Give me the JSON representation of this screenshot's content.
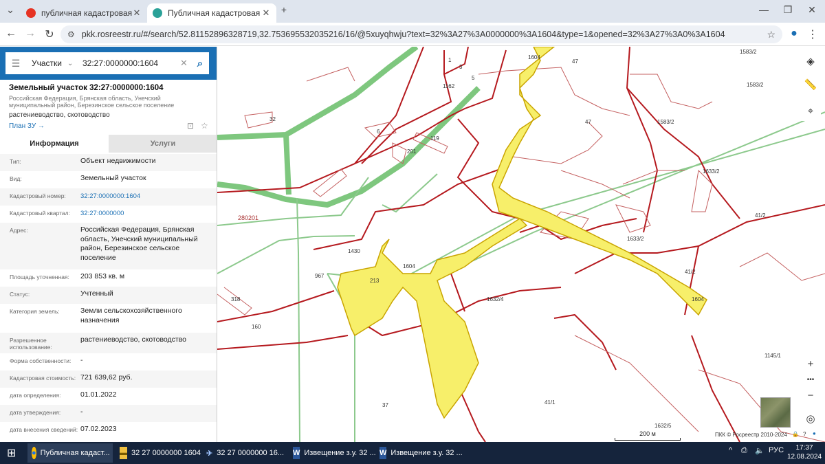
{
  "browser": {
    "tabs": [
      {
        "title": "публичная кадастровая карта",
        "favicon_color": "#e63323"
      },
      {
        "title": "Публичная кадастровая карта",
        "favicon_color": "#2aa198"
      }
    ],
    "url": "pkk.rosreestr.ru/#/search/52.81152896328719,32.753695532035216/16/@5xuyqhwju?text=32%3A27%3A0000000%3A1604&type=1&opened=32%3A27%3A0%3A1604"
  },
  "search": {
    "kind": "Участки",
    "query": "32:27:0000000:1604"
  },
  "object": {
    "title": "Земельный участок 32:27:0000000:1604",
    "address": "Российская Федерация, Брянская область, Унечский муниципальный район, Березинское сельское поселение",
    "use": "растениеводство, скотоводство",
    "plan_link": "План ЗУ →"
  },
  "tabs": {
    "info": "Информация",
    "services": "Услуги"
  },
  "attributes": [
    {
      "k": "Тип:",
      "v": "Объект недвижимости"
    },
    {
      "k": "Вид:",
      "v": "Земельный участок"
    },
    {
      "k": "Кадастровый номер:",
      "v": "32:27:0000000:1604",
      "link": true
    },
    {
      "k": "Кадастровый квартал:",
      "v": "32:27:0000000",
      "link": true
    },
    {
      "k": "Адрес:",
      "v": "Российская Федерация, Брянская область, Унечский муниципальный район, Березинское сельское поселение"
    },
    {
      "k": "Площадь уточненная:",
      "v": "203 853 кв. м"
    },
    {
      "k": "Статус:",
      "v": "Учтенный"
    },
    {
      "k": "Категория земель:",
      "v": "Земли сельскохозяйственного назначения"
    },
    {
      "k": "Разрешенное использование:",
      "v": "растениеводство, скотоводство"
    },
    {
      "k": "Форма собственности:",
      "v": "-"
    },
    {
      "k": "Кадастровая стоимость:",
      "v": "721 639,62 руб."
    },
    {
      "k": "дата определения:",
      "v": "01.01.2022"
    },
    {
      "k": "дата утверждения:",
      "v": "-"
    },
    {
      "k": "дата внесения сведений:",
      "v": "07.02.2023"
    }
  ],
  "map": {
    "parcel_labels": [
      "1604",
      "47",
      "1583/2",
      "1583/2",
      "47",
      "1583/2",
      "1633/2",
      "41/2",
      "1633/2",
      "41/2",
      "1632/4",
      "213",
      "967",
      "1430",
      "201",
      "119",
      "6",
      "32",
      "5",
      "1",
      "3",
      "1162",
      "280201",
      "318",
      "160",
      "37",
      "41/1",
      "1632/5",
      "1145/1",
      "1604",
      "1604"
    ],
    "scale_label": "200 м",
    "copyright": "ПКК © Росреестр 2010-2024",
    "highlight_color": "#f7ef6a"
  },
  "taskbar": {
    "items": [
      {
        "label": "Публичная кадаст...",
        "icon": "chrome-icon"
      },
      {
        "label": "32 27 0000000 1604",
        "icon": "folder-icon"
      },
      {
        "label": "32  27  0000000  16...",
        "icon": "app-icon"
      },
      {
        "label": "Извещение з.у. 32 ...",
        "icon": "word-icon"
      },
      {
        "label": "Извещение з.у. 32 ...",
        "icon": "word-icon"
      }
    ],
    "lang": "РУС",
    "time": "17:37",
    "date": "12.08.2024"
  }
}
